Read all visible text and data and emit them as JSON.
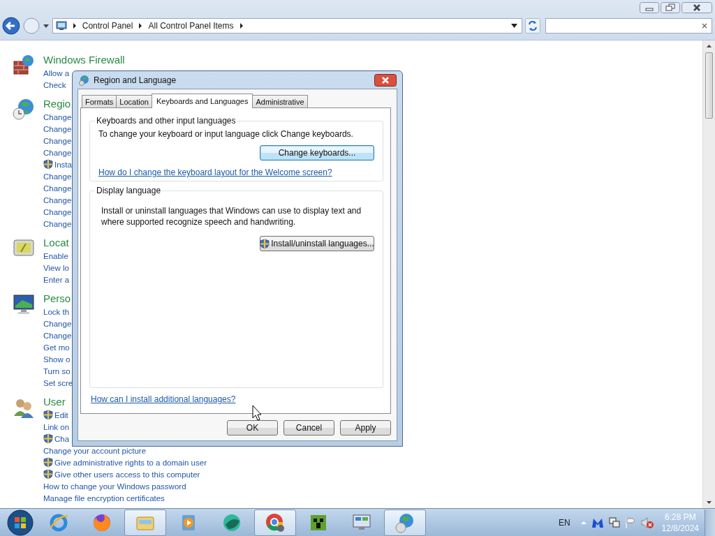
{
  "address_bar": {
    "breadcrumb": [
      {
        "label": "Control Panel"
      },
      {
        "label": "All Control Panel Items"
      }
    ]
  },
  "categories": [
    {
      "kind": "firewall",
      "title": "Windows Firewall",
      "links": [
        {
          "text": "Allow a",
          "shield": false
        },
        {
          "text": "Check",
          "shield": false
        }
      ]
    },
    {
      "kind": "region",
      "title": "Regio",
      "links": [
        {
          "text": "Change",
          "shield": false
        },
        {
          "text": "Change",
          "shield": false
        },
        {
          "text": "Change",
          "shield": false
        },
        {
          "text": "Change",
          "shield": false
        },
        {
          "text": "Insta",
          "shield": true
        },
        {
          "text": "Change",
          "shield": false
        },
        {
          "text": "Change",
          "shield": false
        },
        {
          "text": "Change",
          "shield": false
        },
        {
          "text": "Change",
          "shield": false
        },
        {
          "text": "Change",
          "shield": false
        }
      ]
    },
    {
      "kind": "location",
      "title": "Locat",
      "links": [
        {
          "text": "Enable",
          "shield": false
        },
        {
          "text": "View lo",
          "shield": false
        },
        {
          "text": "Enter a",
          "shield": false
        }
      ]
    },
    {
      "kind": "personalization",
      "title": "Perso",
      "links": [
        {
          "text": "Lock th",
          "shield": false
        },
        {
          "text": "Change",
          "shield": false
        },
        {
          "text": "Change",
          "shield": false
        },
        {
          "text": "Get mo",
          "shield": false
        },
        {
          "text": "Show o",
          "shield": false
        },
        {
          "text": "Turn so",
          "shield": false
        },
        {
          "text": "Set scre",
          "shield": false
        }
      ]
    },
    {
      "kind": "users",
      "title": "User",
      "links": [
        {
          "text": "Edit",
          "shield": true
        },
        {
          "text": "Link on",
          "shield": false
        },
        {
          "text": "Cha",
          "shield": true
        },
        {
          "text": "Change your account picture",
          "shield": false
        },
        {
          "text": "Give administrative rights to a domain user",
          "shield": true
        },
        {
          "text": "Give other users access to this computer",
          "shield": true
        },
        {
          "text": "How to change your Windows password",
          "shield": false
        },
        {
          "text": "Manage file encryption certificates",
          "shield": false
        }
      ]
    }
  ],
  "dialog": {
    "title": "Region and Language",
    "tabs": [
      {
        "label": "Formats",
        "selected": false
      },
      {
        "label": "Location",
        "selected": false
      },
      {
        "label": "Keyboards and Languages",
        "selected": true
      },
      {
        "label": "Administrative",
        "selected": false
      }
    ],
    "groups": [
      {
        "legend": "Keyboards and other input languages",
        "text": "To change your keyboard or input language click Change keyboards.",
        "button": {
          "label": "Change keyboards...",
          "shield": false,
          "focused": true
        },
        "link": "How do I change the keyboard layout for the Welcome screen?"
      },
      {
        "legend": "Display language",
        "text": "Install or uninstall languages that Windows can use to display text and where supported recognize speech and handwriting.",
        "button": {
          "label": "Install/uninstall languages...",
          "shield": true,
          "focused": false
        }
      }
    ],
    "footer_link": "How can I install additional languages?",
    "buttons": [
      {
        "label": "OK"
      },
      {
        "label": "Cancel"
      },
      {
        "label": "Apply"
      }
    ]
  },
  "taskbar": {
    "apps": [
      {
        "kind": "ie",
        "active": false
      },
      {
        "kind": "firefox",
        "active": false
      },
      {
        "kind": "explorer",
        "active": true
      },
      {
        "kind": "media",
        "active": false
      },
      {
        "kind": "ball",
        "active": false
      },
      {
        "kind": "chrome",
        "active": true
      },
      {
        "kind": "block",
        "active": false
      },
      {
        "kind": "monitor",
        "active": false
      },
      {
        "kind": "globe",
        "active": true
      }
    ],
    "language": "EN",
    "time": "6:28 PM",
    "date": "12/8/2024"
  }
}
